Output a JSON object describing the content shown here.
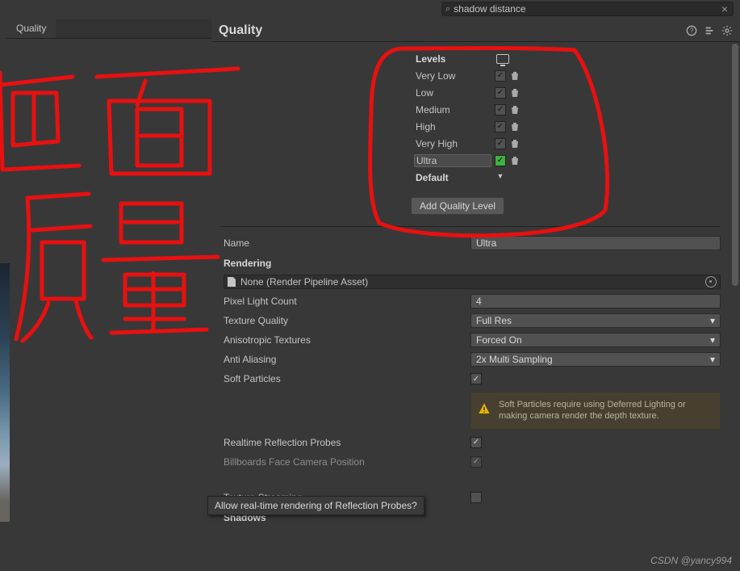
{
  "search": {
    "value": "shadow distance"
  },
  "sidebar": {
    "tab": "Quality"
  },
  "header": {
    "title": "Quality"
  },
  "levels": {
    "header": "Levels",
    "items": [
      {
        "name": "Very Low",
        "enabled": true,
        "selected": false
      },
      {
        "name": "Low",
        "enabled": true,
        "selected": false
      },
      {
        "name": "Medium",
        "enabled": true,
        "selected": false
      },
      {
        "name": "High",
        "enabled": true,
        "selected": false
      },
      {
        "name": "Very High",
        "enabled": true,
        "selected": false
      },
      {
        "name": "Ultra",
        "enabled": true,
        "selected": true
      }
    ],
    "default_label": "Default",
    "add_button": "Add Quality Level"
  },
  "fields": {
    "name_label": "Name",
    "name_value": "Ultra",
    "rendering_section": "Rendering",
    "render_pipeline_value": "None (Render Pipeline Asset)",
    "pixel_light_label": "Pixel Light Count",
    "pixel_light_value": "4",
    "texture_quality_label": "Texture Quality",
    "texture_quality_value": "Full Res",
    "aniso_label": "Anisotropic Textures",
    "aniso_value": "Forced On",
    "aa_label": "Anti Aliasing",
    "aa_value": "2x Multi Sampling",
    "soft_particles_label": "Soft Particles",
    "soft_particles_checked": true,
    "soft_particles_warning": "Soft Particles require using Deferred Lighting or making camera render the depth texture.",
    "realtime_refl_label": "Realtime Reflection Probes",
    "realtime_refl_checked": true,
    "billboards_label": "Billboards Face Camera Position",
    "texture_streaming_label": "Texture Streaming",
    "texture_streaming_checked": false,
    "shadows_section": "Shadows"
  },
  "tooltip": "Allow real-time rendering of Reflection Probes?",
  "watermark": "CSDN @yancy994"
}
